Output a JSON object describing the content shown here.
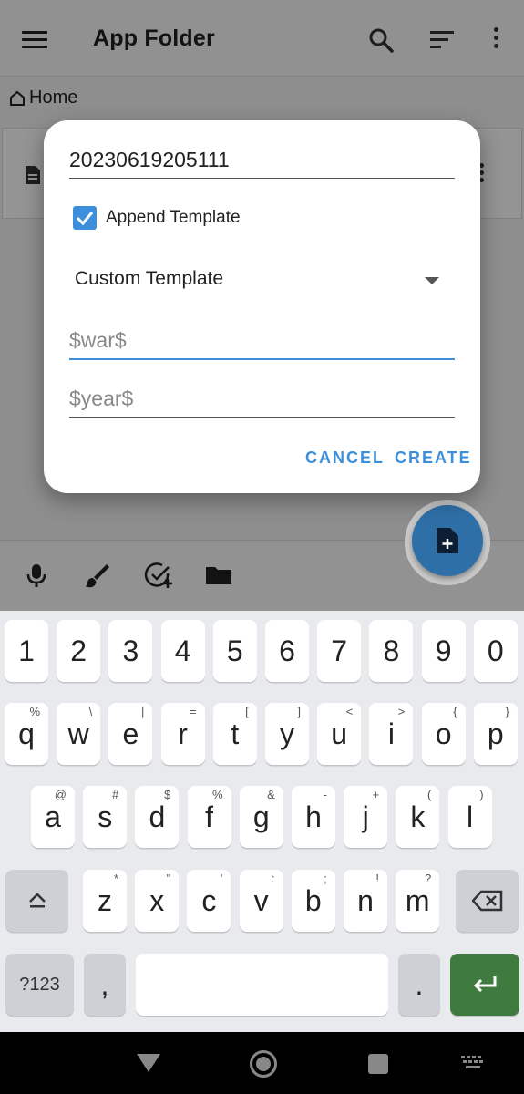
{
  "appbar": {
    "title": "App Folder",
    "icons": [
      "menu-icon",
      "search-icon",
      "sort-icon",
      "more-vert-icon"
    ]
  },
  "breadcrumb": {
    "label": "Home",
    "icon": "home-icon"
  },
  "dialog": {
    "name_value": "20230619205111",
    "append_template_label": "Append Template",
    "append_template_checked": true,
    "template_selected": "Custom Template",
    "war_placeholder": "$war$",
    "year_placeholder": "$year$",
    "cancel_label": "CANCEL",
    "create_label": "CREATE"
  },
  "toolbar": {
    "icons": [
      "mic-icon",
      "brush-icon",
      "add-task-icon",
      "folder-icon"
    ]
  },
  "fab": {
    "icon": "add-note-icon",
    "color": "#2f6fa8"
  },
  "keyboard": {
    "row_numbers": [
      "1",
      "2",
      "3",
      "4",
      "5",
      "6",
      "7",
      "8",
      "9",
      "0"
    ],
    "row1": [
      {
        "k": "q",
        "h": "%"
      },
      {
        "k": "w",
        "h": "\\"
      },
      {
        "k": "e",
        "h": "|"
      },
      {
        "k": "r",
        "h": "="
      },
      {
        "k": "t",
        "h": "["
      },
      {
        "k": "y",
        "h": "]"
      },
      {
        "k": "u",
        "h": "<"
      },
      {
        "k": "i",
        "h": ">"
      },
      {
        "k": "o",
        "h": "{"
      },
      {
        "k": "p",
        "h": "}"
      }
    ],
    "row2": [
      {
        "k": "a",
        "h": "@"
      },
      {
        "k": "s",
        "h": "#"
      },
      {
        "k": "d",
        "h": "$"
      },
      {
        "k": "f",
        "h": "%"
      },
      {
        "k": "g",
        "h": "&"
      },
      {
        "k": "h",
        "h": "-"
      },
      {
        "k": "j",
        "h": "+"
      },
      {
        "k": "k",
        "h": "("
      },
      {
        "k": "l",
        "h": ")"
      }
    ],
    "row3": [
      {
        "k": "z",
        "h": "*"
      },
      {
        "k": "x",
        "h": "\""
      },
      {
        "k": "c",
        "h": "'"
      },
      {
        "k": "v",
        "h": ":"
      },
      {
        "k": "b",
        "h": ";"
      },
      {
        "k": "n",
        "h": "!"
      },
      {
        "k": "m",
        "h": "?"
      }
    ],
    "symbols_label": "?123",
    "comma_label": ",",
    "period_label": ".",
    "accent_color": "#3f7a3f"
  },
  "colors": {
    "accent": "#3d8fdb",
    "scrim": "rgba(0,0,0,0.42)"
  }
}
